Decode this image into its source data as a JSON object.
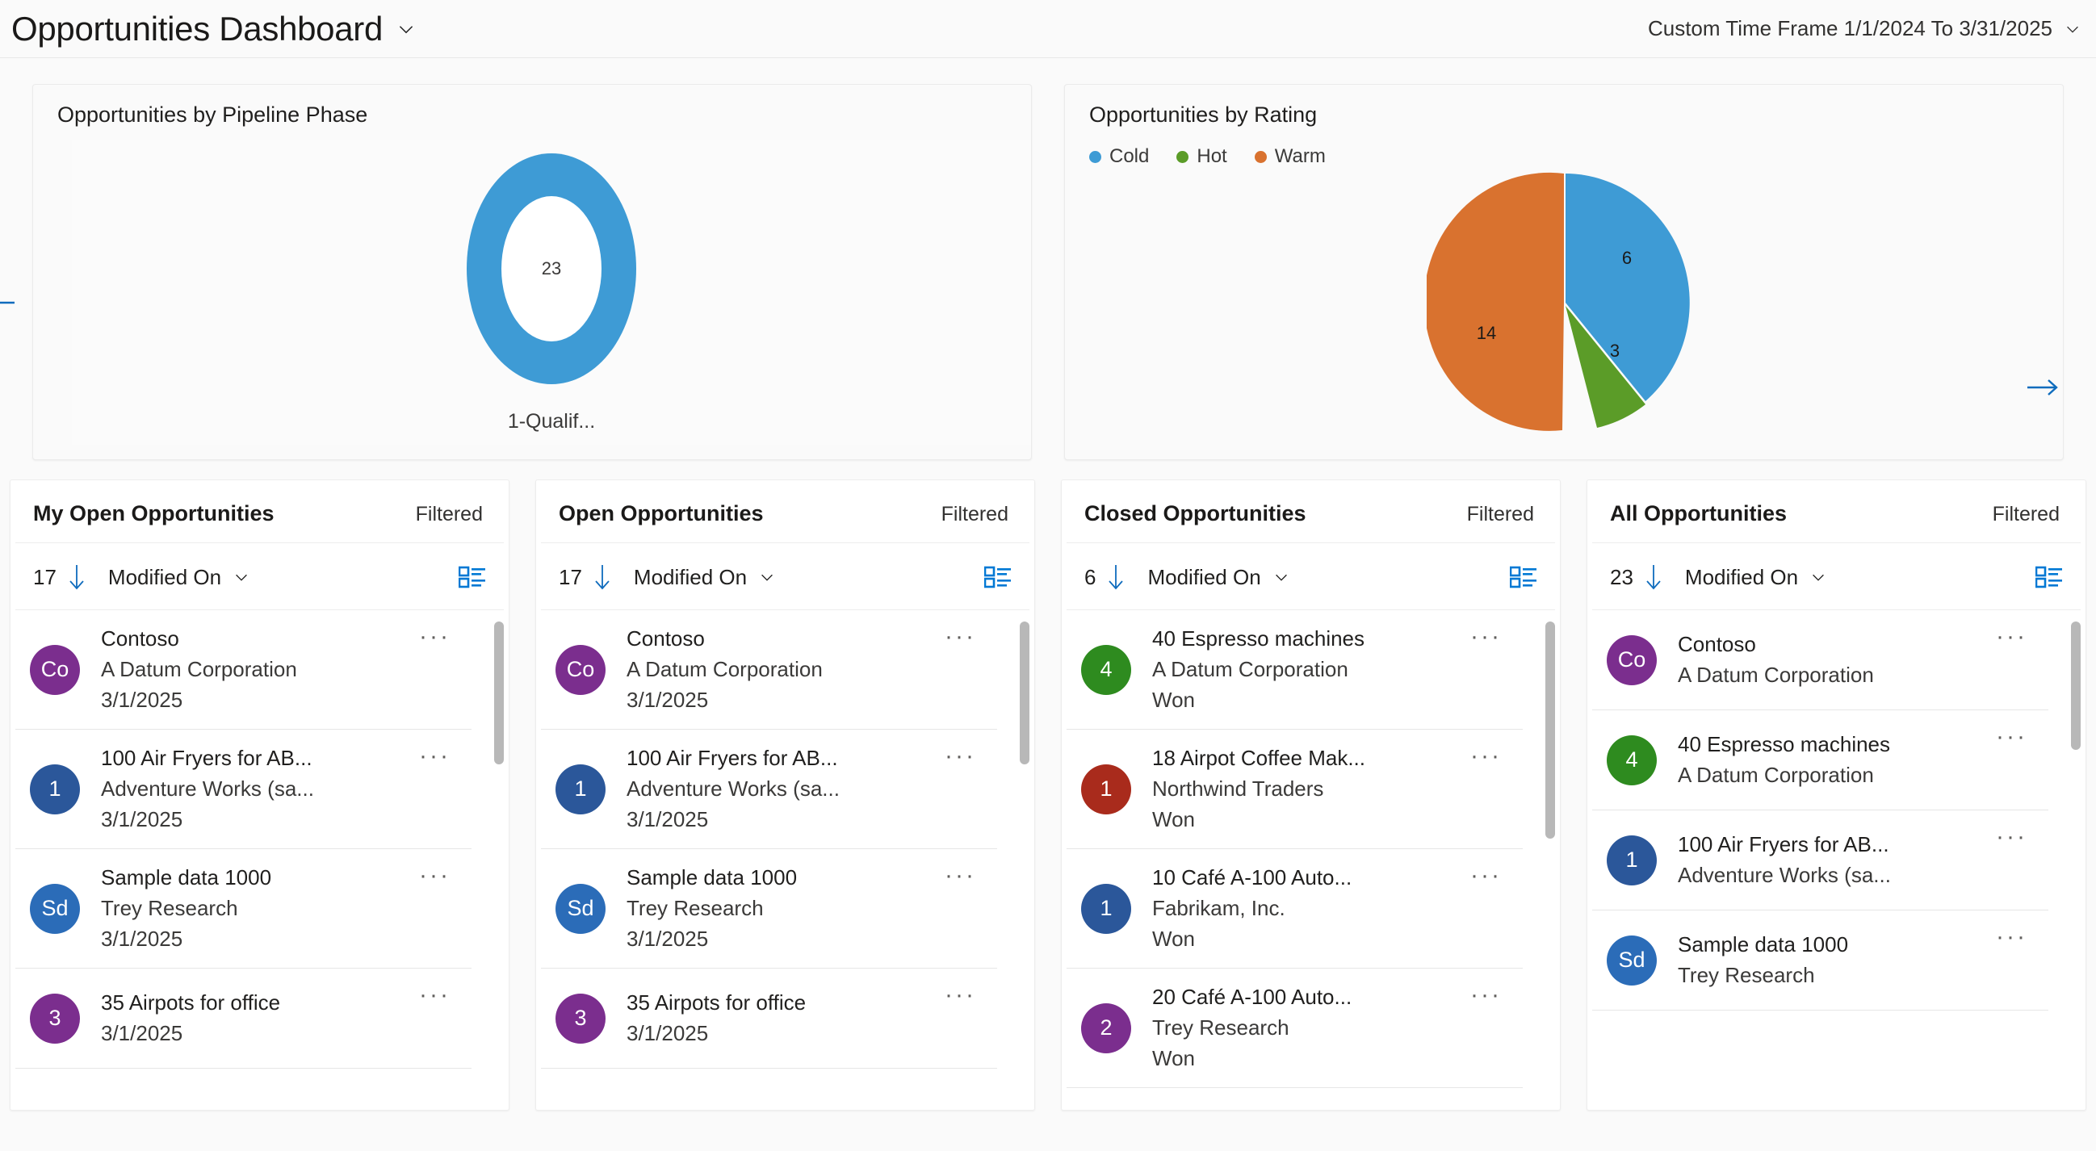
{
  "header": {
    "title": "Opportunities Dashboard",
    "title_caret_icon": "chevron-down-icon",
    "time_frame": "Custom Time Frame 1/1/2024 To 3/31/2025",
    "time_frame_caret_icon": "chevron-down-icon"
  },
  "nav": {
    "prev_icon": "arrow-left-icon",
    "next_icon": "arrow-right-icon"
  },
  "charts": [
    {
      "title": "Opportunities by Pipeline Phase"
    },
    {
      "title": "Opportunities by Rating"
    }
  ],
  "chart_data": [
    {
      "type": "pie",
      "variant": "donut",
      "title": "Opportunities by Pipeline Phase",
      "categories": [
        "1-Qualif..."
      ],
      "values": [
        23
      ],
      "colors": [
        "#3e9bd5"
      ],
      "center_label": "23",
      "legend": false,
      "xlabel": "",
      "ylabel": ""
    },
    {
      "type": "pie",
      "title": "Opportunities by Rating",
      "categories": [
        "Cold",
        "Hot",
        "Warm"
      ],
      "values": [
        6,
        3,
        14
      ],
      "colors": [
        "#3e9bd5",
        "#5b9c28",
        "#d9722f"
      ],
      "legend": true,
      "legend_position": "top-left",
      "xlabel": "",
      "ylabel": ""
    }
  ],
  "panels": [
    {
      "title": "My Open Opportunities",
      "filtered_label": "Filtered",
      "count": "17",
      "sort_arrow_icon": "arrow-down-icon",
      "sort_field": "Modified On",
      "sort_caret_icon": "chevron-down-icon",
      "view_icon": "list-view-icon",
      "more_label": "···",
      "scroll": {
        "top_pct": 1,
        "height_pct": 29
      },
      "items": [
        {
          "initials": "Co",
          "color": "#7b2e8e",
          "primary": "Contoso",
          "secondary": "A Datum Corporation",
          "tertiary": "3/1/2025"
        },
        {
          "initials": "1",
          "color": "#2b579a",
          "primary": "100 Air Fryers for AB...",
          "secondary": "Adventure Works (sa...",
          "tertiary": "3/1/2025"
        },
        {
          "initials": "Sd",
          "color": "#2b6cb8",
          "primary": "Sample data 1000",
          "secondary": "Trey Research",
          "tertiary": "3/1/2025"
        },
        {
          "initials": "3",
          "color": "#7b2e8e",
          "primary": "35 Airpots for office",
          "secondary": "3/1/2025",
          "tertiary": ""
        }
      ]
    },
    {
      "title": "Open Opportunities",
      "filtered_label": "Filtered",
      "count": "17",
      "sort_arrow_icon": "arrow-down-icon",
      "sort_field": "Modified On",
      "sort_caret_icon": "chevron-down-icon",
      "view_icon": "list-view-icon",
      "more_label": "···",
      "scroll": {
        "top_pct": 1,
        "height_pct": 29
      },
      "items": [
        {
          "initials": "Co",
          "color": "#7b2e8e",
          "primary": "Contoso",
          "secondary": "A Datum Corporation",
          "tertiary": "3/1/2025"
        },
        {
          "initials": "1",
          "color": "#2b579a",
          "primary": "100 Air Fryers for AB...",
          "secondary": "Adventure Works (sa...",
          "tertiary": "3/1/2025"
        },
        {
          "initials": "Sd",
          "color": "#2b6cb8",
          "primary": "Sample data 1000",
          "secondary": "Trey Research",
          "tertiary": "3/1/2025"
        },
        {
          "initials": "3",
          "color": "#7b2e8e",
          "primary": "35 Airpots for office",
          "secondary": "3/1/2025",
          "tertiary": ""
        }
      ]
    },
    {
      "title": "Closed Opportunities",
      "filtered_label": "Filtered",
      "count": "6",
      "sort_arrow_icon": "arrow-down-icon",
      "sort_field": "Modified On",
      "sort_caret_icon": "chevron-down-icon",
      "view_icon": "list-view-icon",
      "more_label": "···",
      "scroll": {
        "top_pct": 1,
        "height_pct": 44
      },
      "items": [
        {
          "initials": "4",
          "color": "#2e8b1f",
          "primary": "40 Espresso machines",
          "secondary": "A Datum Corporation",
          "tertiary": "Won"
        },
        {
          "initials": "1",
          "color": "#a92b1c",
          "primary": "18 Airpot Coffee Mak...",
          "secondary": "Northwind Traders",
          "tertiary": "Won"
        },
        {
          "initials": "1",
          "color": "#2b579a",
          "primary": "10 Café A-100 Auto...",
          "secondary": "Fabrikam, Inc.",
          "tertiary": "Won"
        },
        {
          "initials": "2",
          "color": "#7b2e8e",
          "primary": "20 Café A-100 Auto...",
          "secondary": "Trey Research",
          "tertiary": "Won"
        }
      ]
    },
    {
      "title": "All Opportunities",
      "filtered_label": "Filtered",
      "count": "23",
      "sort_arrow_icon": "arrow-down-icon",
      "sort_field": "Modified On",
      "sort_caret_icon": "chevron-down-icon",
      "view_icon": "list-view-icon",
      "more_label": "···",
      "scroll": {
        "top_pct": 1,
        "height_pct": 26
      },
      "items": [
        {
          "initials": "Co",
          "color": "#7b2e8e",
          "primary": "Contoso",
          "secondary": "A Datum Corporation",
          "tertiary": ""
        },
        {
          "initials": "4",
          "color": "#2e8b1f",
          "primary": "40 Espresso machines",
          "secondary": "A Datum Corporation",
          "tertiary": ""
        },
        {
          "initials": "1",
          "color": "#2b579a",
          "primary": "100 Air Fryers for AB...",
          "secondary": "Adventure Works (sa...",
          "tertiary": ""
        },
        {
          "initials": "Sd",
          "color": "#2b6cb8",
          "primary": "Sample data 1000",
          "secondary": "Trey Research",
          "tertiary": ""
        }
      ]
    }
  ]
}
